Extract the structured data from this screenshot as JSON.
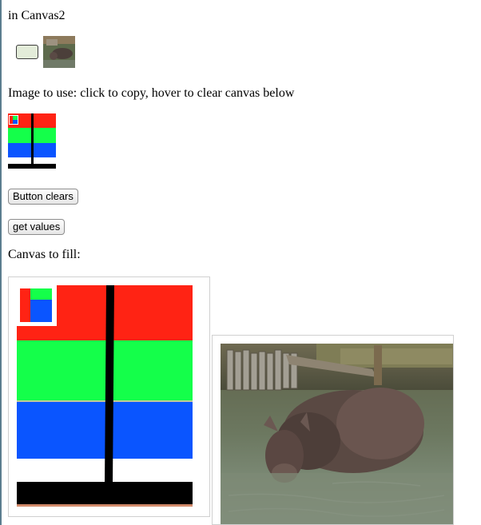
{
  "heading": "in Canvas2",
  "instructions": "Image to use: click to copy, hover to clear canvas below",
  "buttons": {
    "clear_label": "Button clears",
    "values_label": "get values"
  },
  "canvas_label": "Canvas to fill:",
  "colors": {
    "red": "#ff2314",
    "green": "#14ff4a",
    "blue": "#0a55ff",
    "black": "#000000",
    "white": "#ffffff"
  }
}
